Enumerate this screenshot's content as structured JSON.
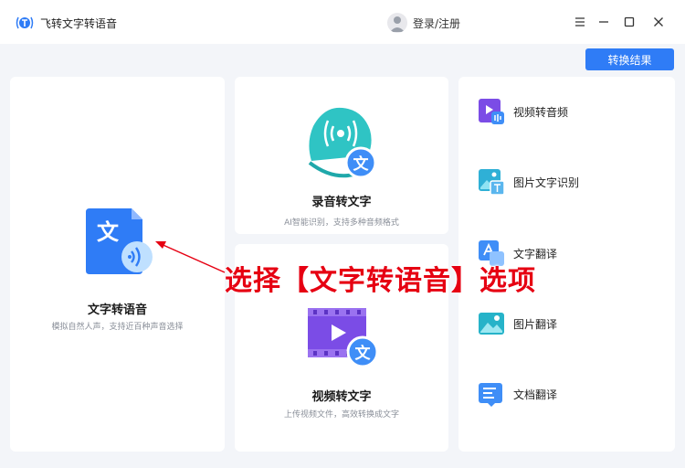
{
  "app": {
    "title": "飞转文字转语音"
  },
  "header": {
    "login_label": "登录/注册"
  },
  "toolbar": {
    "convert_results_label": "转换结果"
  },
  "cards": {
    "text_to_speech": {
      "title": "文字转语音",
      "desc": "模拟自然人声，支持近百种声音选择"
    },
    "recording_to_text": {
      "title": "录音转文字",
      "desc": "AI智能识别，支持多种音频格式"
    },
    "video_to_text": {
      "title": "视频转文字",
      "desc": "上传视频文件，高效转换成文字"
    }
  },
  "side_items": [
    {
      "label": "视频转音频",
      "icon": "video-audio-icon"
    },
    {
      "label": "图片文字识别",
      "icon": "image-ocr-icon"
    },
    {
      "label": "文字翻译",
      "icon": "text-translate-icon"
    },
    {
      "label": "图片翻译",
      "icon": "image-translate-icon"
    },
    {
      "label": "文档翻译",
      "icon": "document-translate-icon"
    }
  ],
  "icon_glyph": "文",
  "annotation": {
    "text": "选择【文字转语音】选项"
  },
  "colors": {
    "accent": "#2f7cf6",
    "annotation_red": "#e60012",
    "purple": "#7b4ce6"
  }
}
